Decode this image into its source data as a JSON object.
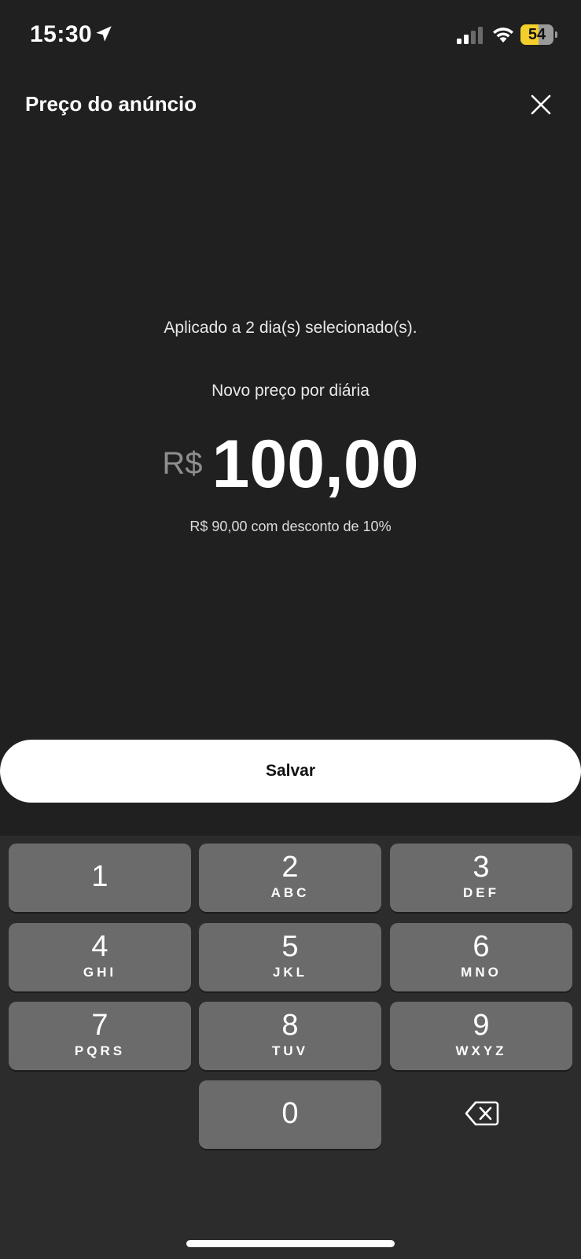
{
  "status_bar": {
    "time": "15:30",
    "battery_level": "54",
    "battery_percent": 54,
    "battery_color": "#f4cf2b",
    "icons": [
      "location-arrow-icon",
      "signal-icon",
      "wifi-icon",
      "battery-icon"
    ]
  },
  "header": {
    "title": "Preço do anúncio",
    "close_icon": "close-icon"
  },
  "content": {
    "applied_text": "Aplicado a 2 dia(s) selecionado(s).",
    "price_label": "Novo preço por diária",
    "currency": "R$",
    "price_value": "100,00",
    "discount_text": "R$ 90,00 com desconto de 10%"
  },
  "save_button": {
    "label": "Salvar"
  },
  "keypad": {
    "keys": [
      {
        "digit": "1",
        "letters": ""
      },
      {
        "digit": "2",
        "letters": "ABC"
      },
      {
        "digit": "3",
        "letters": "DEF"
      },
      {
        "digit": "4",
        "letters": "GHI"
      },
      {
        "digit": "5",
        "letters": "JKL"
      },
      {
        "digit": "6",
        "letters": "MNO"
      },
      {
        "digit": "7",
        "letters": "PQRS"
      },
      {
        "digit": "8",
        "letters": "TUV"
      },
      {
        "digit": "9",
        "letters": "WXYZ"
      },
      {
        "digit": "0",
        "letters": ""
      }
    ],
    "backspace_icon": "backspace-icon"
  },
  "colors": {
    "background": "#202020",
    "key_background": "#6b6b6b",
    "keypad_background": "#2c2c2c",
    "button_background": "#ffffff"
  }
}
